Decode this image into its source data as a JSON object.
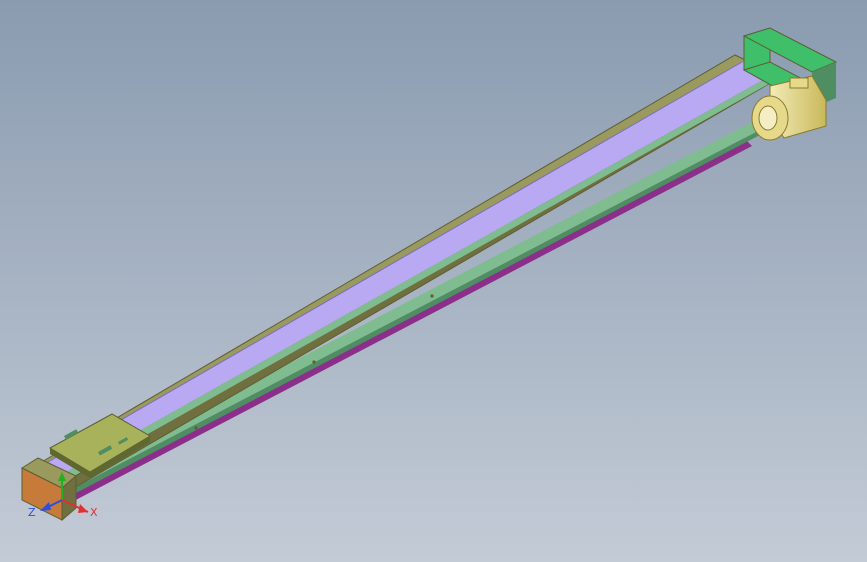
{
  "viewport": {
    "background_top": "#8a9bb0",
    "background_bottom": "#c3cbd6"
  },
  "colors": {
    "rail_top": "#9a9a5e",
    "rail_top_edge": "#5e5e34",
    "rail_side": "#6f6f3f",
    "cover_strip": "#b9a9f2",
    "cover_strip_edge": "#7a6cc0",
    "guide_green": "#7fbc8f",
    "guide_green_dark": "#4f8e62",
    "profile_purple": "#8b2f8b",
    "profile_purple_light": "#b054b0",
    "carriage": "#a8b25a",
    "carriage_edge": "#5f6830",
    "end_block_orange": "#c77b3a",
    "motor_flange_green": "#3fbf6a",
    "motor_body_yellow": "#e6d98a",
    "axis_x": "#e23030",
    "axis_y": "#22b022",
    "axis_z": "#2b4fe0"
  },
  "icons": {
    "triad": "xyz-axis-triad-icon"
  },
  "axis_triad": {
    "x_label": "X",
    "z_label": "Z"
  }
}
